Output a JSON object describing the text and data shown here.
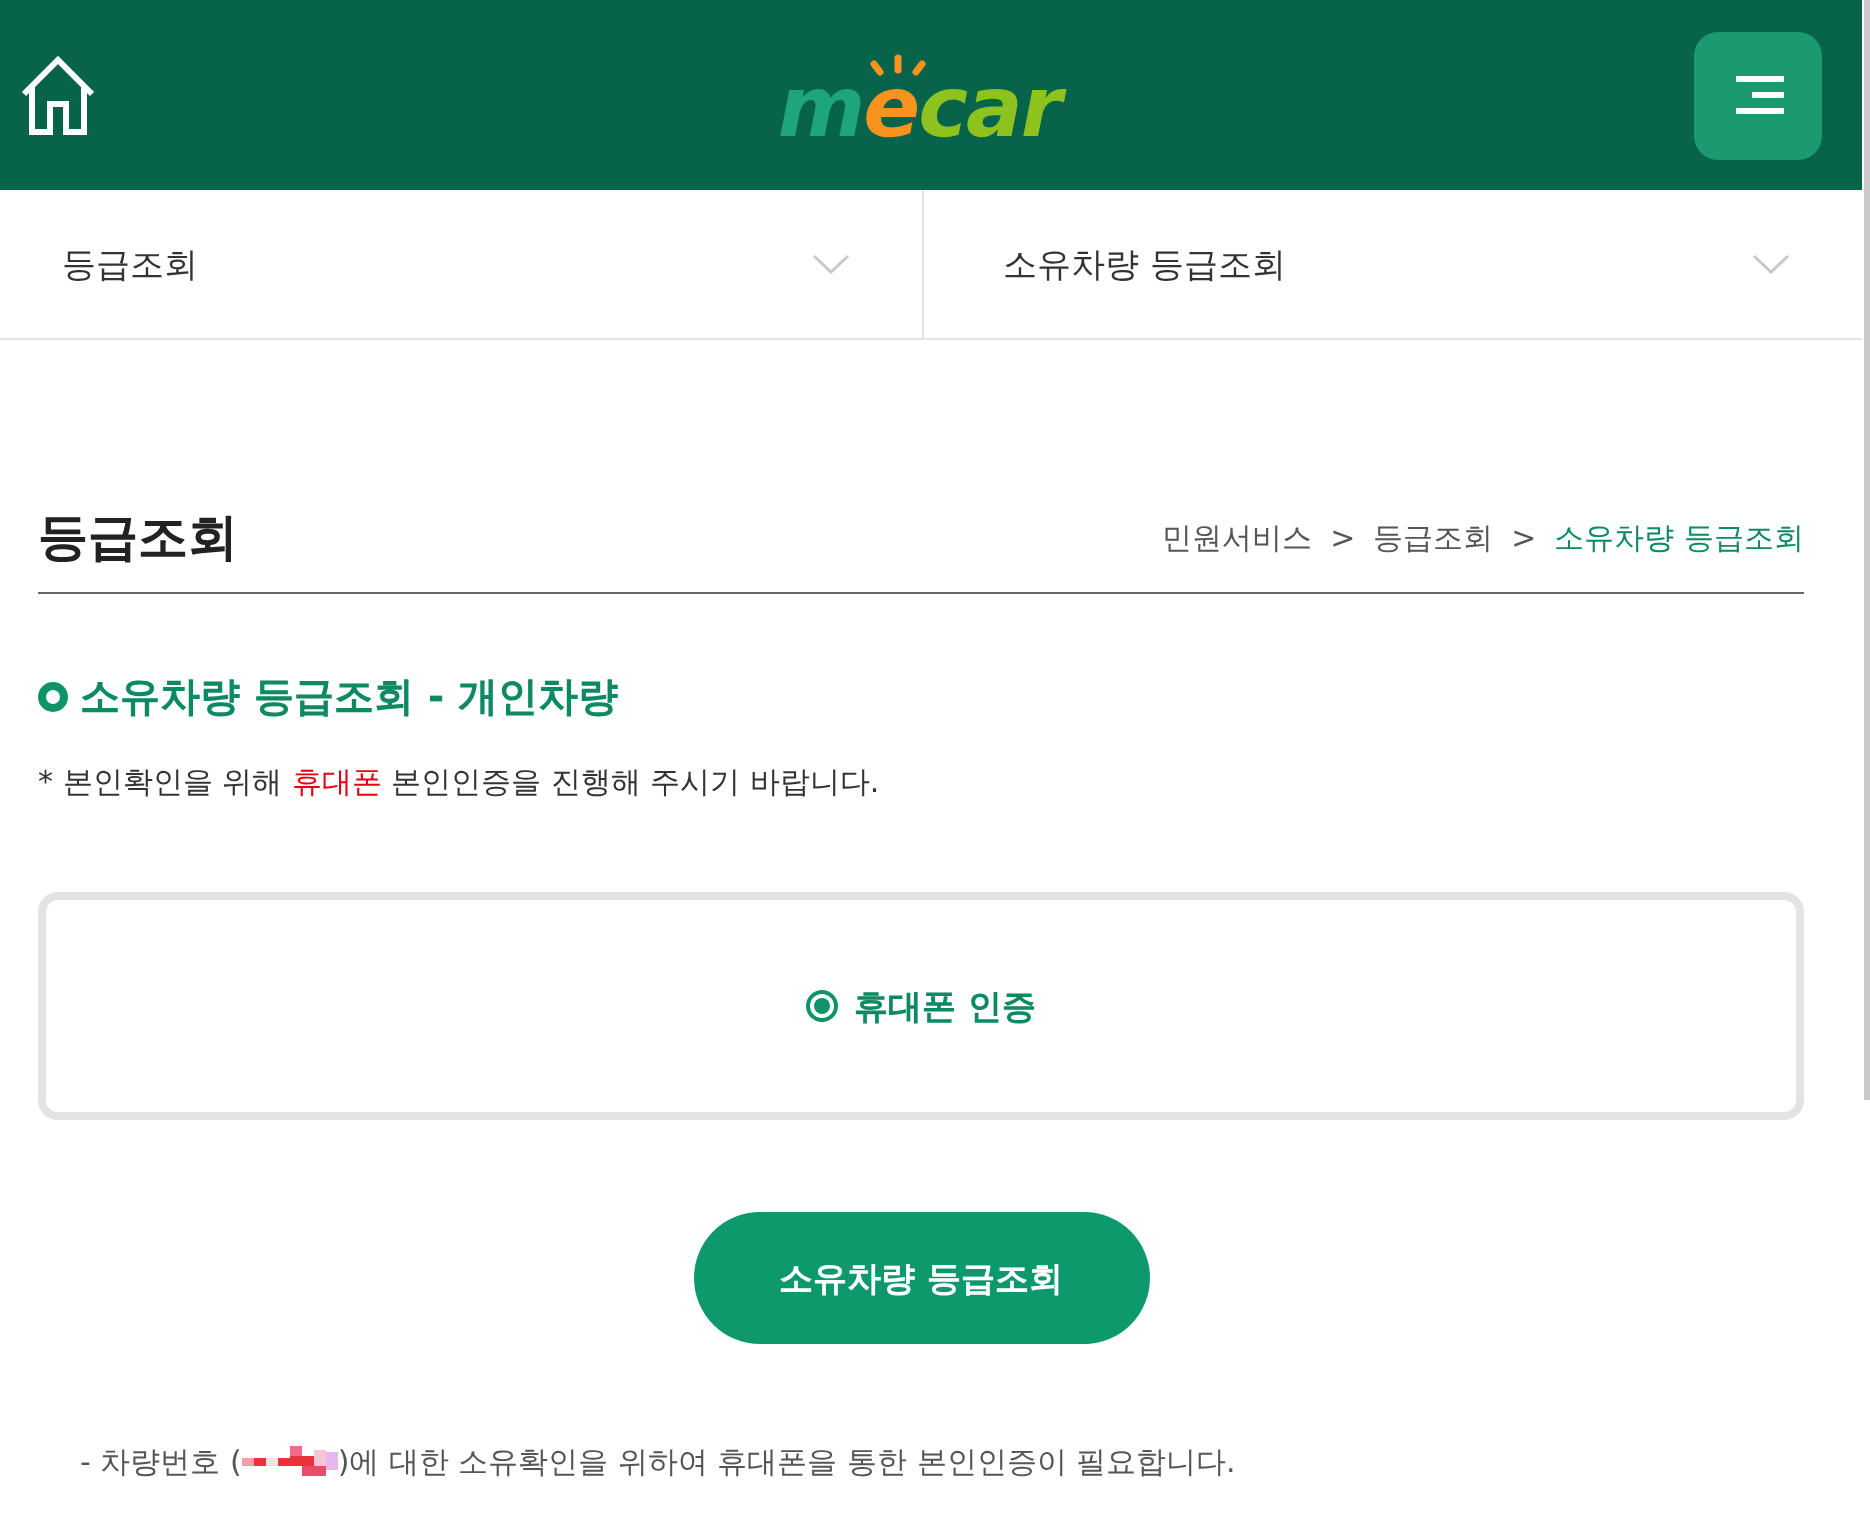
{
  "header": {
    "logo": {
      "parts": [
        "m",
        "e",
        "car"
      ]
    }
  },
  "dropdowns": [
    {
      "label": "등급조회"
    },
    {
      "label": "소유차량 등급조회"
    }
  ],
  "page_title": "등급조회",
  "breadcrumb": {
    "items": [
      {
        "label": "민원서비스",
        "selected": false
      },
      {
        "label": "등급조회",
        "selected": false
      },
      {
        "label": "소유차량 등급조회",
        "selected": true
      }
    ],
    "separators": [
      ">",
      ">"
    ]
  },
  "section": {
    "heading": "소유차량 등급조회 - 개인차량",
    "notice": {
      "before": "* 본인확인을 위해 ",
      "highlight": "휴대폰",
      "after": " 본인인증을 진행해 주시기 바랍니다."
    }
  },
  "auth_options": [
    {
      "label": "휴대폰 인증",
      "selected": true
    }
  ],
  "submit_button": "소유차량 등급조회",
  "footnote": {
    "before": "- 차량번호 (",
    "after": ")에 대한 소유확인을 위하여 휴대폰을 통한 본인인증이 필요합니다."
  }
}
